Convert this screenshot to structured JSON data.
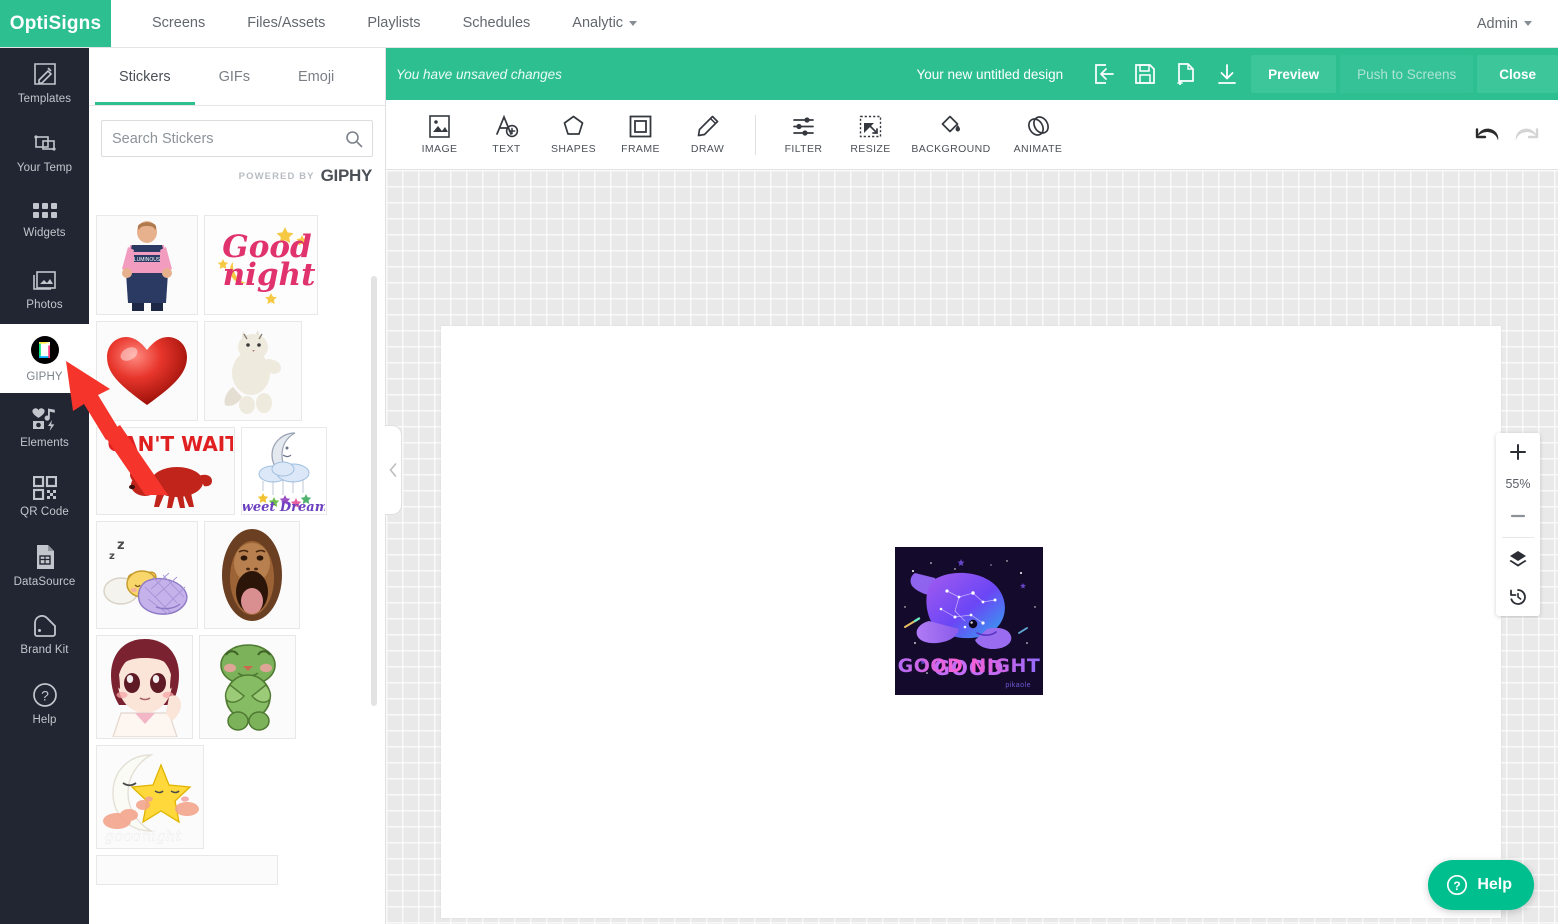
{
  "topnav": {
    "brand": "OptiSigns",
    "links": [
      {
        "label": "Screens",
        "dropdown": false
      },
      {
        "label": "Files/Assets",
        "dropdown": false
      },
      {
        "label": "Playlists",
        "dropdown": false
      },
      {
        "label": "Schedules",
        "dropdown": false
      },
      {
        "label": "Analytic",
        "dropdown": true
      }
    ],
    "account": "Admin"
  },
  "rail": {
    "items": [
      {
        "label": "Templates",
        "icon": "templates-icon",
        "active": false
      },
      {
        "label": "Your Temp",
        "icon": "your-templates-icon",
        "active": false
      },
      {
        "label": "Widgets",
        "icon": "widgets-icon",
        "active": false
      },
      {
        "label": "Photos",
        "icon": "photos-icon",
        "active": false
      },
      {
        "label": "GIPHY",
        "icon": "giphy-icon",
        "active": true
      },
      {
        "label": "Elements",
        "icon": "elements-icon",
        "active": false
      },
      {
        "label": "QR Code",
        "icon": "qr-code-icon",
        "active": false
      },
      {
        "label": "DataSource",
        "icon": "datasource-icon",
        "active": false
      },
      {
        "label": "Brand Kit",
        "icon": "brand-kit-icon",
        "active": false
      },
      {
        "label": "Help",
        "icon": "help-circle-icon",
        "active": false
      }
    ]
  },
  "panel": {
    "tabs": [
      {
        "label": "Stickers",
        "active": true
      },
      {
        "label": "GIFs",
        "active": false
      },
      {
        "label": "Emoji",
        "active": false
      }
    ],
    "search": {
      "value": "",
      "placeholder": "Search Stickers",
      "icon": "search-icon"
    },
    "powered_prefix": "POWERED BY",
    "powered_brand": "GIPHY",
    "stickers": [
      {
        "name": "cricket-player-sticker",
        "caption": "LUMINOUS"
      },
      {
        "name": "good-night-text-sticker",
        "caption": "Good night"
      },
      {
        "name": "red-heart-sticker",
        "caption": ""
      },
      {
        "name": "dancing-cat-sticker",
        "caption": ""
      },
      {
        "name": "cant-wait-dog-sticker",
        "caption": "I CAN'T WAIT"
      },
      {
        "name": "sweet-dreams-moon-sticker",
        "caption": "Sweet Dreams"
      },
      {
        "name": "sleeping-bear-sticker",
        "caption": "z z"
      },
      {
        "name": "orangutan-face-sticker",
        "caption": ""
      },
      {
        "name": "anime-girl-sticker",
        "caption": ""
      },
      {
        "name": "green-frog-sticker",
        "caption": ""
      },
      {
        "name": "moon-star-goodnight-sticker",
        "caption": "goodnight"
      }
    ],
    "collapse_icon": "chevron-left-icon"
  },
  "editor": {
    "status": "You have unsaved changes",
    "design_name": "Your new untitled design",
    "actions": [
      {
        "name": "rename-design-icon",
        "title": "Rename"
      },
      {
        "name": "save-icon",
        "title": "Save"
      },
      {
        "name": "save-as-copy-icon",
        "title": "Save as copy"
      },
      {
        "name": "download-icon",
        "title": "Download"
      }
    ],
    "buttons": [
      {
        "label": "Preview",
        "state": "enabled"
      },
      {
        "label": "Push to Screens",
        "state": "disabled"
      },
      {
        "label": "Close",
        "state": "enabled"
      }
    ],
    "toolbar": [
      {
        "label": "IMAGE",
        "icon": "image-icon"
      },
      {
        "label": "TEXT",
        "icon": "add-text-icon"
      },
      {
        "label": "SHAPES",
        "icon": "shapes-icon"
      },
      {
        "label": "FRAME",
        "icon": "frame-icon"
      },
      {
        "label": "DRAW",
        "icon": "pencil-icon"
      },
      {
        "label": "FILTER",
        "icon": "filter-sliders-icon"
      },
      {
        "label": "RESIZE",
        "icon": "resize-icon"
      },
      {
        "label": "BACKGROUND",
        "icon": "paint-bucket-icon"
      },
      {
        "label": "ANIMATE",
        "icon": "animate-icon"
      }
    ],
    "history": [
      {
        "name": "undo-icon",
        "state": "enabled"
      },
      {
        "name": "redo-icon",
        "state": "disabled"
      }
    ],
    "zoom": {
      "in_label": "+",
      "level": "55%",
      "out_label": "—",
      "layers_icon": "layers-icon",
      "history_icon": "version-history-icon"
    },
    "artwork": {
      "name": "good-night-whale-artwork",
      "caption": "GOOD NIGHT",
      "credit": "pikaole",
      "bg_color": "#140a2b"
    }
  },
  "help_widget": {
    "label": "Help",
    "icon": "question-circle-icon"
  },
  "annotation": {
    "name": "red-arrow-pointing-to-giphy",
    "color": "#f5342b"
  },
  "colors": {
    "brand_green": "#2ebf91",
    "help_green": "#00bf8f",
    "rail_dark": "#222633",
    "canvas_gray": "#e9e9e9"
  }
}
